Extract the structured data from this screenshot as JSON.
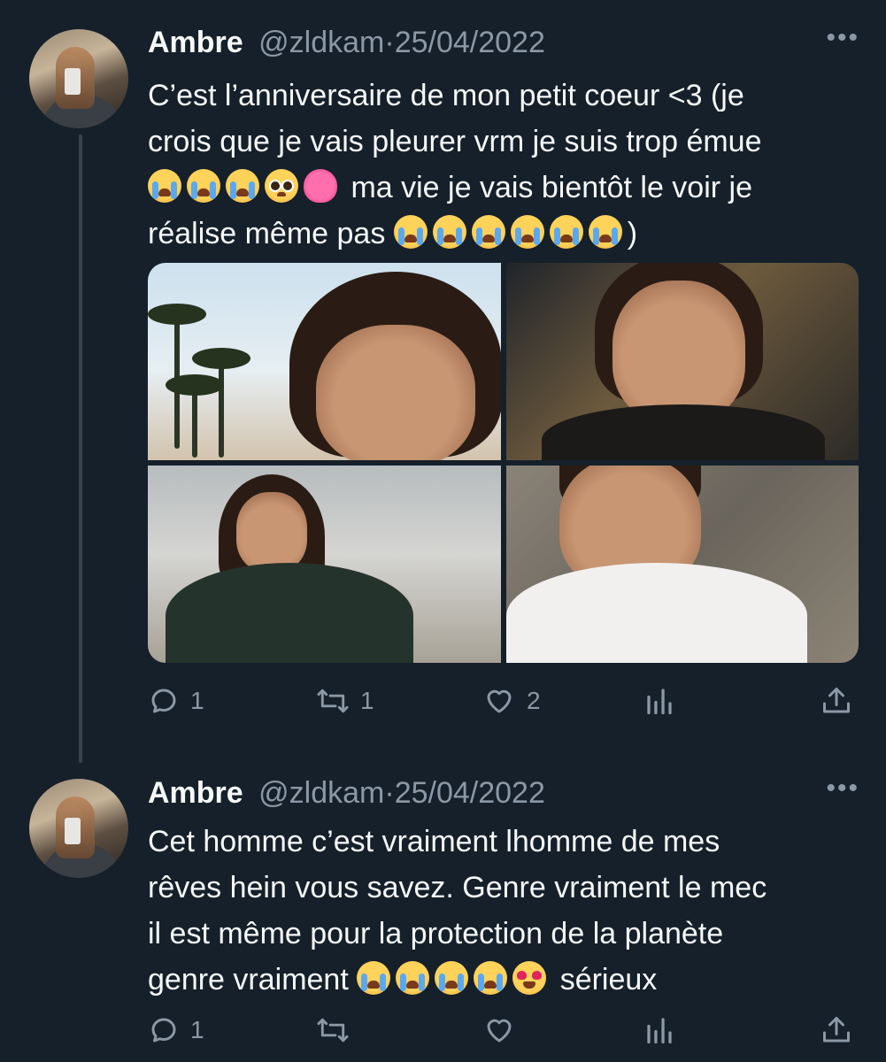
{
  "tweets": [
    {
      "author_name": "Ambre",
      "handle": "@zldkam",
      "separator": "·",
      "date": "25/04/2022",
      "more_label": "•••",
      "text_line1": "C’est l’anniversaire de mon petit coeur <3 (je",
      "text_line2": "crois que je vais pleurer vrm je suis trop émue",
      "text_line3_after_emojis": "ma vie je vais bientôt le voir je",
      "text_line4_before_emojis": "réalise même pas",
      "text_line4_end": ")",
      "reply_count": "1",
      "retweet_count": "1",
      "like_count": "2"
    },
    {
      "author_name": "Ambre",
      "handle": "@zldkam",
      "separator": "·",
      "date": "25/04/2022",
      "more_label": "•••",
      "text_line1": "Cet homme c’est vraiment lhomme de mes",
      "text_line2": "rêves hein vous savez. Genre vraiment le mec",
      "text_line3": "il est même pour la protection de la planète",
      "text_line4_before_emojis": "genre vraiment",
      "text_line4_after_emojis": "sérieux",
      "reply_count": "1",
      "retweet_count": "",
      "like_count": ""
    }
  ],
  "colors": {
    "background": "#15202b",
    "text": "#f7f9f9",
    "secondary": "#8b98a5",
    "thread_line": "#38444d"
  },
  "icons": {
    "reply": "speech-bubble-icon",
    "retweet": "retweet-arrows-icon",
    "like": "heart-outline-icon",
    "views": "bar-chart-icon",
    "share": "upload-arrow-icon",
    "more": "ellipsis-icon"
  }
}
